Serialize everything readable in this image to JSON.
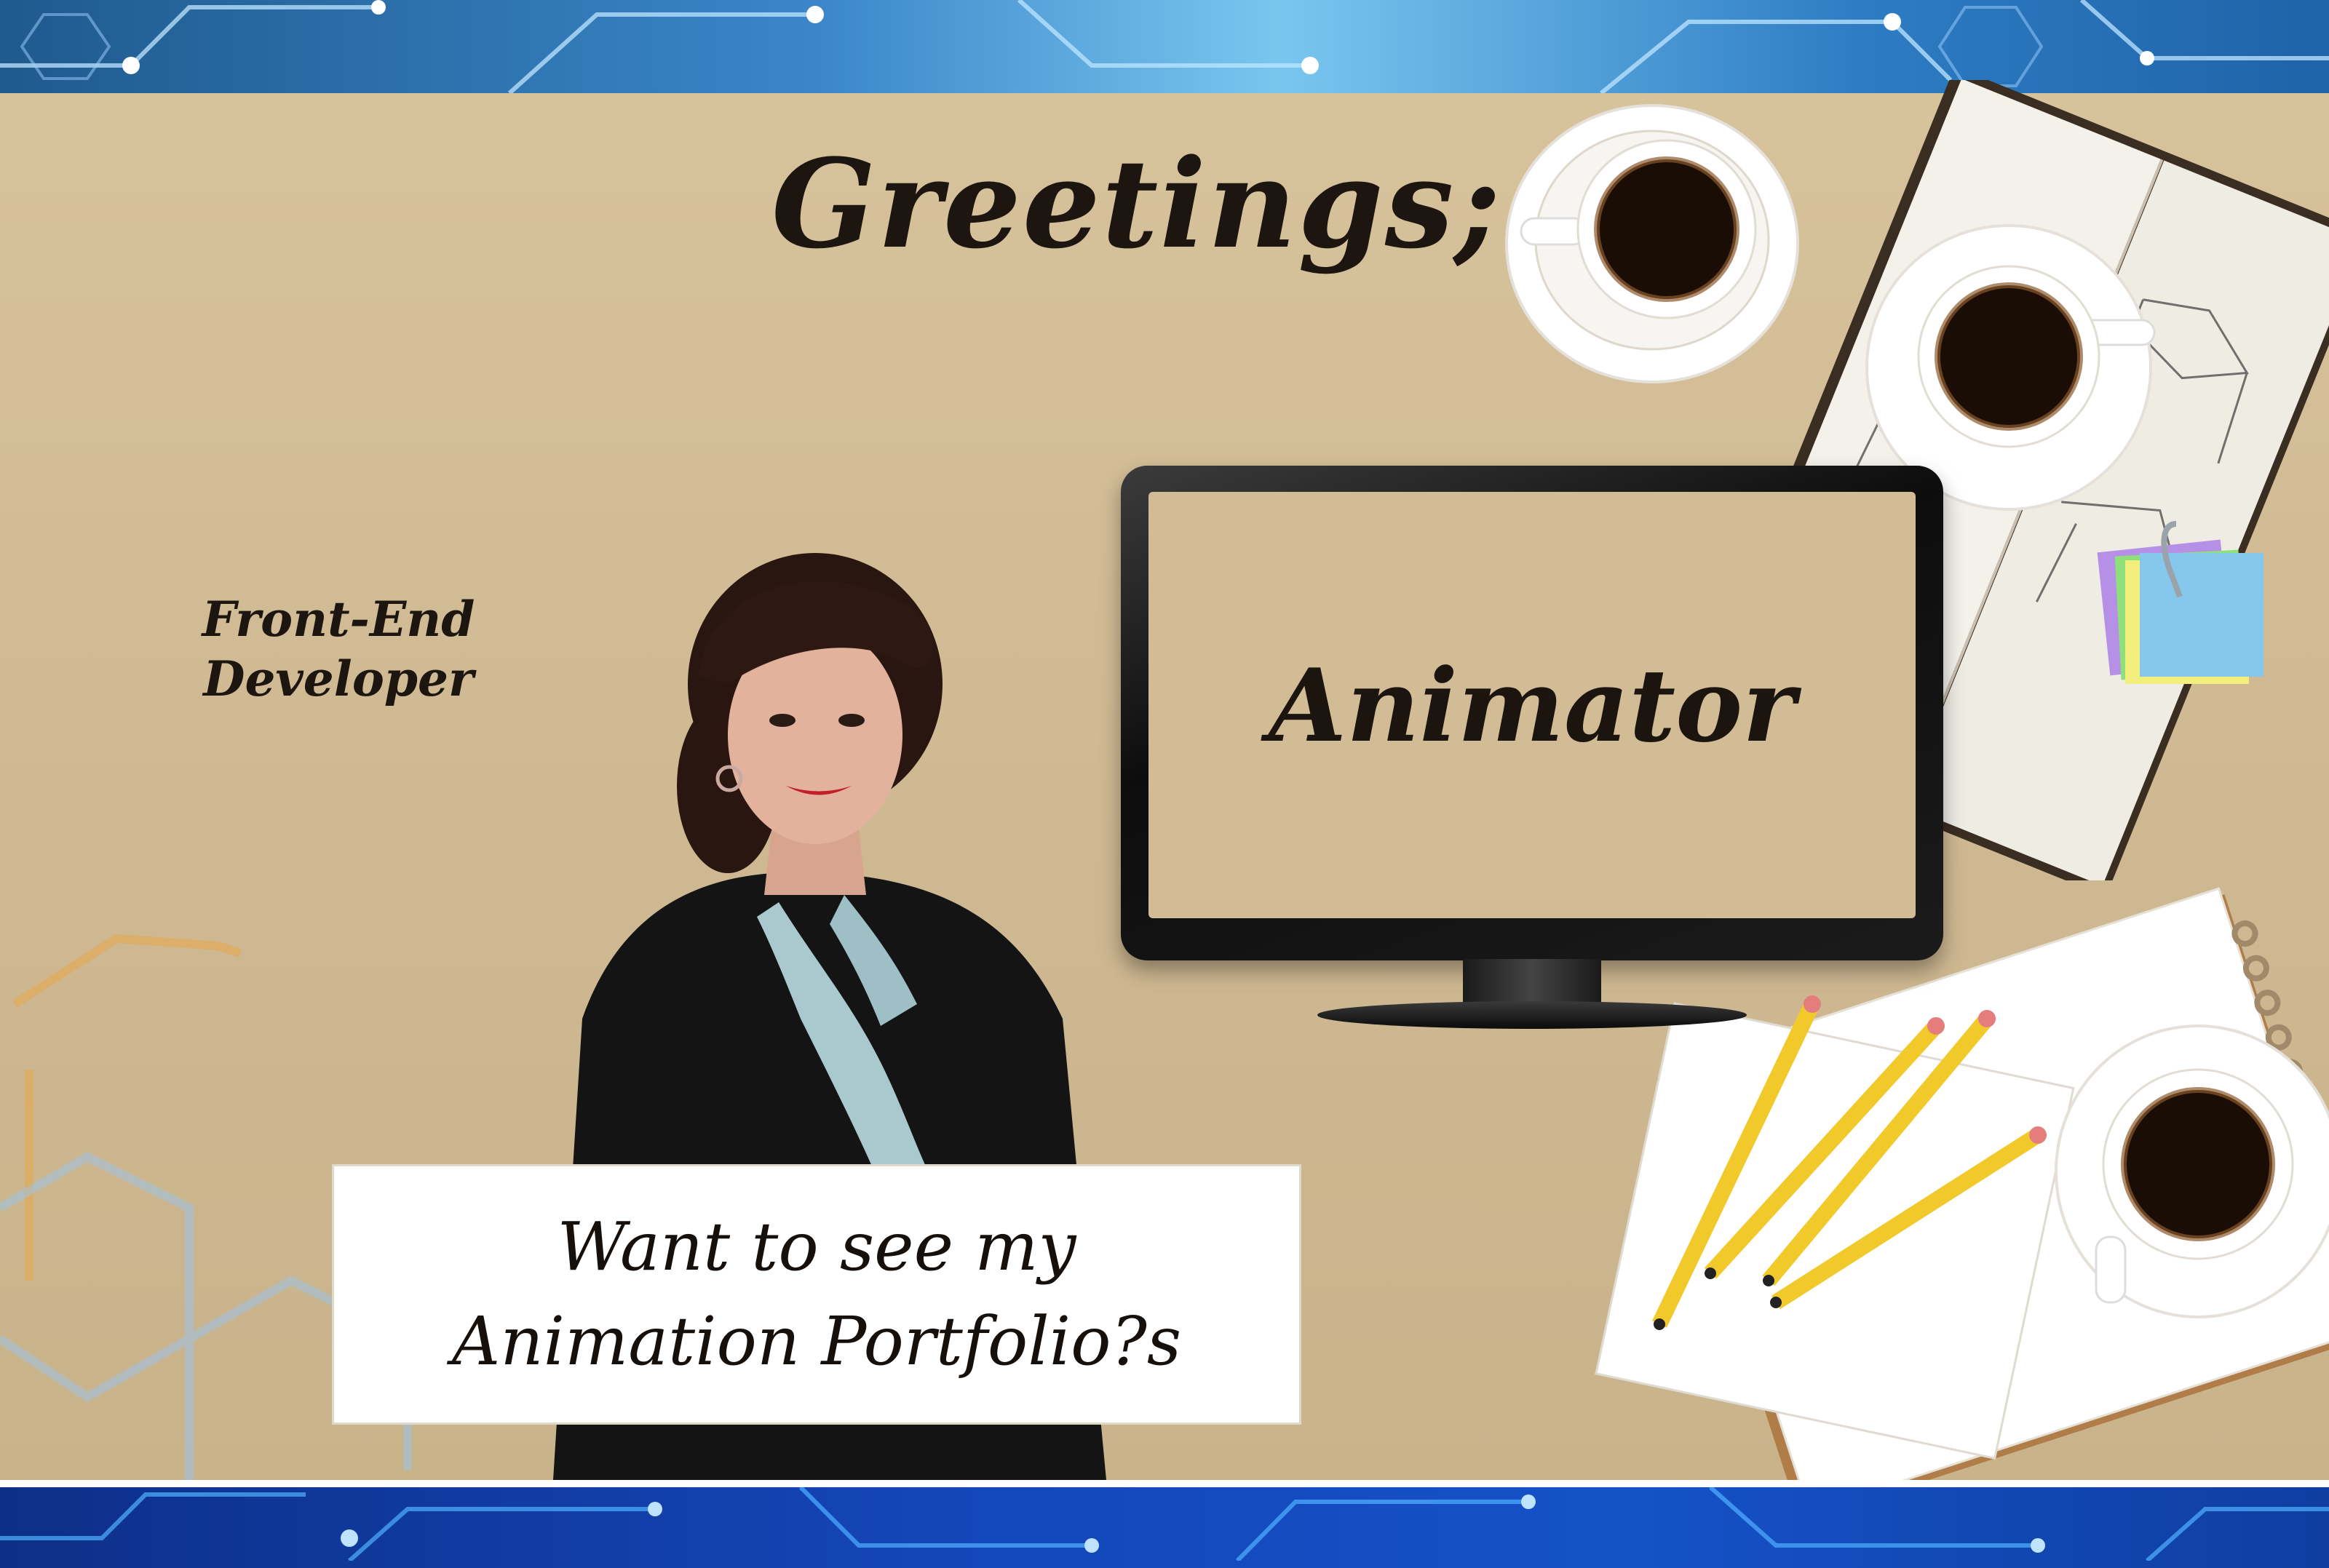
{
  "heading": {
    "text": "Greetings;"
  },
  "roles": {
    "line1": "Front-End",
    "line2": "Developer"
  },
  "monitor": {
    "screen_text": "Animator"
  },
  "cta": {
    "line1": "Want to see my",
    "line2": "Animation Portfolio?s"
  },
  "colors": {
    "desk": "#d0bb93",
    "top_band": "#3a86c9",
    "bottom_band": "#1446b8",
    "text": "#1c1510",
    "pencil": "#f2c92b"
  },
  "icons": [
    "coffee-cup-icon",
    "notebook-icon",
    "sticky-notes-icon",
    "pencil-icon",
    "monitor-icon",
    "circuit-icon"
  ]
}
